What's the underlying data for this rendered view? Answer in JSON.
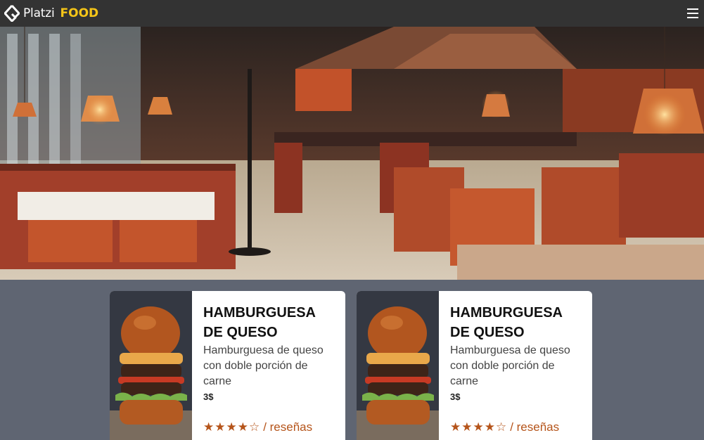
{
  "nav": {
    "logo_text": "Platzi",
    "logo_highlight": "FOOD",
    "menu_icon": "hamburger-menu-icon"
  },
  "hero": {
    "alt": "restaurant interior"
  },
  "products": [
    {
      "title": "HAMBURGUESA DE QUESO",
      "description": "Hamburguesa de queso con doble porción de carne",
      "price": "3$",
      "rating": 4,
      "stars": "★★★★☆",
      "reviews_label": "/ reseñas"
    },
    {
      "title": "HAMBURGUESA DE QUESO",
      "description": "Hamburguesa de queso con doble porción de carne",
      "price": "3$",
      "rating": 4,
      "stars": "★★★★☆",
      "reviews_label": "/ reseñas"
    }
  ]
}
